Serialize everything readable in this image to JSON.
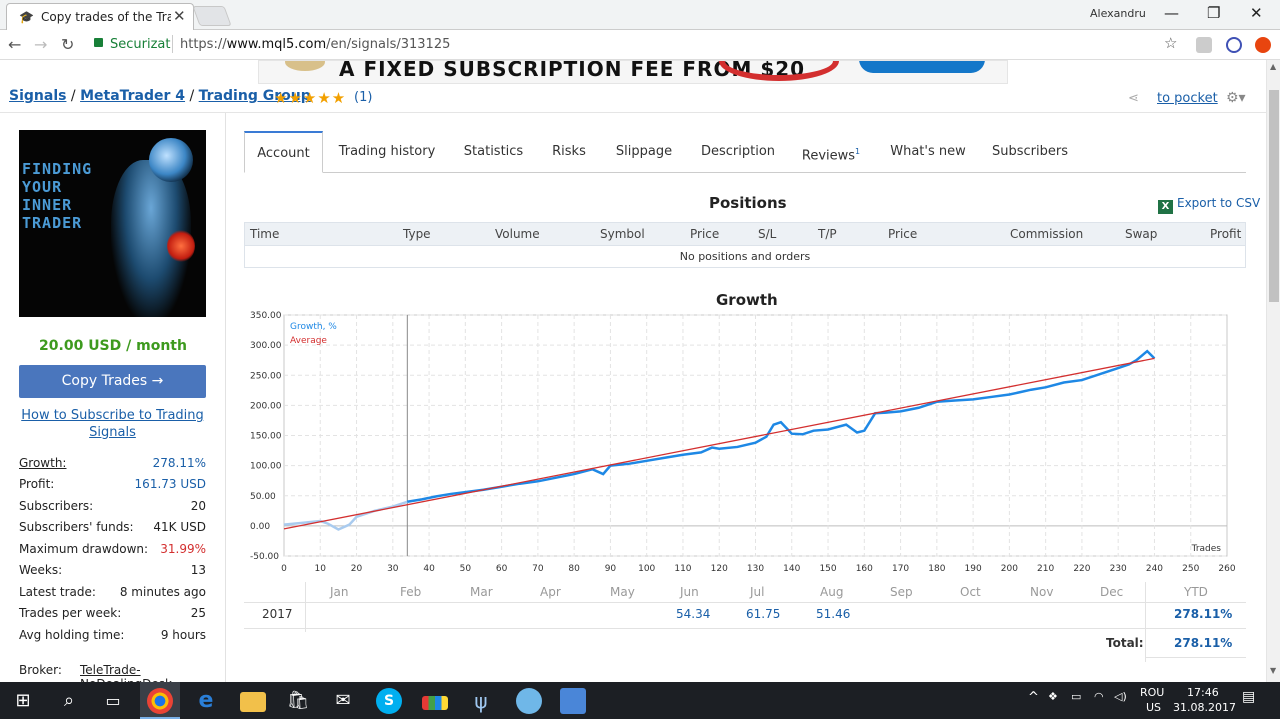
{
  "browser": {
    "tab_title": "Copy trades of the Tradin",
    "user": "Alexandru",
    "secure_label": "Securizat",
    "url_prefix": "https://",
    "url_host": "www.mql5.com",
    "url_path": "/en/signals/313125"
  },
  "banner": {
    "text": "A FIXED SUBSCRIPTION FEE FROM $20"
  },
  "breadcrumb": {
    "signals": "Signals",
    "sep1": "/",
    "mt4": "MetaTrader 4",
    "sep2": "/",
    "group": "Trading Group"
  },
  "rating": {
    "stars": "★★★★★",
    "count": "(1)"
  },
  "actions": {
    "pocket": "to pocket"
  },
  "avatar": {
    "line1": "FINDING",
    "line2": "YOUR",
    "line3": "INNER",
    "line4": "TRADER"
  },
  "sidebar": {
    "price": "20.00 USD / month",
    "copy_button": "Copy Trades →",
    "howto_link": "How to Subscribe to Trading Signals",
    "stats": [
      {
        "key": "Growth:",
        "value": "278.11%"
      },
      {
        "key": "Profit:",
        "value": "161.73 USD"
      },
      {
        "key": "Subscribers:",
        "value": "20"
      },
      {
        "key": "Subscribers' funds:",
        "value": "41K USD"
      },
      {
        "key": "Maximum drawdown:",
        "value": "31.99%"
      },
      {
        "key": "Weeks:",
        "value": "13"
      },
      {
        "key": "Latest trade:",
        "value": "8 minutes ago"
      },
      {
        "key": "Trades per week:",
        "value": "25"
      },
      {
        "key": "Avg holding time:",
        "value": "9 hours"
      }
    ],
    "broker_label": "Broker:",
    "broker_value": "TeleTrade-NoDealingDesk"
  },
  "tabs": [
    {
      "label": "Account"
    },
    {
      "label": "Trading history"
    },
    {
      "label": "Statistics"
    },
    {
      "label": "Risks"
    },
    {
      "label": "Slippage"
    },
    {
      "label": "Description"
    },
    {
      "label": "Reviews",
      "badge": "1"
    },
    {
      "label": "What's new"
    },
    {
      "label": "Subscribers"
    }
  ],
  "positions": {
    "title": "Positions",
    "export": "Export to CSV",
    "export_icon": "X",
    "columns": [
      "Time",
      "Type",
      "Volume",
      "Symbol",
      "Price",
      "S/L",
      "T/P",
      "Price",
      "Commission",
      "Swap",
      "Profit"
    ],
    "empty": "No positions and orders"
  },
  "growth": {
    "title": "Growth"
  },
  "colors": {
    "growth_line": "#1e88e5",
    "average_line": "#d32f2f",
    "accent": "#3d9a1e",
    "link": "#1a5fa8",
    "button": "#4a76bd"
  },
  "chart_data": {
    "type": "line",
    "legend": [
      "Growth, %",
      "Average"
    ],
    "legend_position": "top-left",
    "xlabel": "Trades",
    "xlim": [
      0,
      260
    ],
    "ylim": [
      -50,
      350
    ],
    "x_ticks": [
      0,
      10,
      20,
      30,
      40,
      50,
      60,
      70,
      80,
      90,
      100,
      110,
      120,
      130,
      140,
      150,
      160,
      170,
      180,
      190,
      200,
      210,
      220,
      230,
      240,
      250,
      260
    ],
    "y_ticks": [
      "-50.00",
      "0.00",
      "50.00",
      "100.00",
      "150.00",
      "200.00",
      "250.00",
      "300.00",
      "350.00"
    ],
    "grid": true,
    "marker_x": 34,
    "series": [
      {
        "name": "Growth, %",
        "x": [
          0,
          5,
          10,
          12,
          15,
          18,
          20,
          25,
          30,
          34,
          38,
          42,
          46,
          50,
          55,
          60,
          65,
          70,
          75,
          80,
          85,
          88,
          90,
          95,
          100,
          105,
          110,
          115,
          118,
          120,
          125,
          130,
          133,
          135,
          137,
          140,
          143,
          146,
          150,
          155,
          158,
          160,
          163,
          166,
          170,
          175,
          180,
          185,
          190,
          195,
          200,
          203,
          206,
          210,
          215,
          220,
          225,
          230,
          233,
          235,
          238,
          240
        ],
        "y": [
          2,
          5,
          8,
          4,
          -6,
          2,
          15,
          25,
          32,
          40,
          44,
          49,
          53,
          56,
          60,
          65,
          70,
          74,
          80,
          86,
          94,
          86,
          100,
          103,
          108,
          113,
          118,
          122,
          130,
          128,
          131,
          138,
          148,
          168,
          172,
          153,
          152,
          158,
          160,
          168,
          155,
          158,
          187,
          188,
          190,
          196,
          206,
          208,
          210,
          214,
          218,
          222,
          226,
          230,
          238,
          242,
          252,
          262,
          268,
          275,
          290,
          278
        ]
      },
      {
        "name": "Average",
        "x": [
          0,
          240
        ],
        "y": [
          -5,
          278
        ]
      }
    ]
  },
  "monthly": {
    "months": [
      "Jan",
      "Feb",
      "Mar",
      "Apr",
      "May",
      "Jun",
      "Jul",
      "Aug",
      "Sep",
      "Oct",
      "Nov",
      "Dec",
      "YTD"
    ],
    "year": "2017",
    "values": [
      "",
      "",
      "",
      "",
      "",
      "54.34",
      "61.75",
      "51.46",
      "",
      "",
      "",
      ""
    ],
    "ytd": "278.11%",
    "total_label": "Total:",
    "total": "278.11%"
  },
  "taskbar": {
    "lang1": "ROU",
    "lang2": "US",
    "time": "17:46",
    "date": "31.08.2017"
  }
}
